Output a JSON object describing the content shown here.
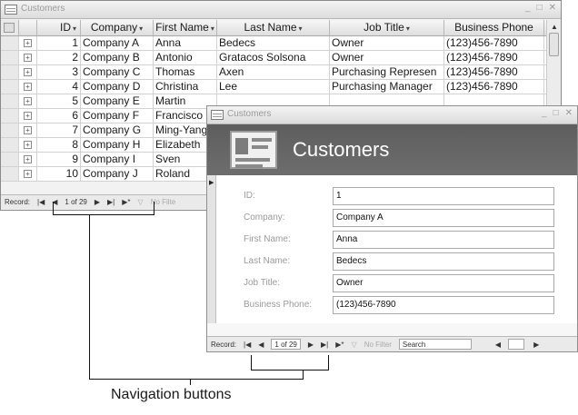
{
  "datasheet": {
    "title": "Customers",
    "columns": [
      "ID",
      "Company",
      "First Name",
      "Last Name",
      "Job Title",
      "Business Phone"
    ],
    "rows": [
      {
        "id": "1",
        "company": "Company A",
        "first": "Anna",
        "last": "Bedecs",
        "job": "Owner",
        "phone": "(123)456-7890"
      },
      {
        "id": "2",
        "company": "Company B",
        "first": "Antonio",
        "last": "Gratacos Solsona",
        "job": "Owner",
        "phone": "(123)456-7890"
      },
      {
        "id": "3",
        "company": "Company C",
        "first": "Thomas",
        "last": "Axen",
        "job": "Purchasing Represen",
        "phone": "(123)456-7890"
      },
      {
        "id": "4",
        "company": "Company D",
        "first": "Christina",
        "last": "Lee",
        "job": "Purchasing Manager",
        "phone": "(123)456-7890"
      },
      {
        "id": "5",
        "company": "Company E",
        "first": "Martin",
        "last": "",
        "job": "",
        "phone": ""
      },
      {
        "id": "6",
        "company": "Company F",
        "first": "Francisco",
        "last": "",
        "job": "",
        "phone": ""
      },
      {
        "id": "7",
        "company": "Company G",
        "first": "Ming-Yang",
        "last": "",
        "job": "",
        "phone": ""
      },
      {
        "id": "8",
        "company": "Company H",
        "first": "Elizabeth",
        "last": "",
        "job": "",
        "phone": ""
      },
      {
        "id": "9",
        "company": "Company I",
        "first": "Sven",
        "last": "",
        "job": "",
        "phone": ""
      },
      {
        "id": "10",
        "company": "Company J",
        "first": "Roland",
        "last": "",
        "job": "",
        "phone": ""
      }
    ],
    "nav": {
      "record_label": "Record:",
      "position": "1 of 29",
      "filter": "No Filte"
    }
  },
  "form": {
    "window_title": "Customers",
    "header_title": "Customers",
    "fields": [
      {
        "label": "ID:",
        "value": "1"
      },
      {
        "label": "Company:",
        "value": "Company A"
      },
      {
        "label": "First Name:",
        "value": "Anna"
      },
      {
        "label": "Last Name:",
        "value": "Bedecs"
      },
      {
        "label": "Job Title:",
        "value": "Owner"
      },
      {
        "label": "Business Phone:",
        "value": "(123)456-7890"
      }
    ],
    "nav": {
      "record_label": "Record:",
      "position": "1 of 29",
      "filter": "No Filter",
      "search": "Search"
    }
  },
  "annotation": {
    "label": "Navigation buttons"
  },
  "icons": {
    "window": "table-window-icon",
    "first_record": "first-record-icon",
    "prev_record": "previous-record-icon",
    "next_record": "next-record-icon",
    "last_record": "last-record-icon",
    "new_record": "new-record-icon",
    "filter": "filter-icon",
    "expand": "expand-plus-icon",
    "sort": "sort-dropdown-icon"
  }
}
